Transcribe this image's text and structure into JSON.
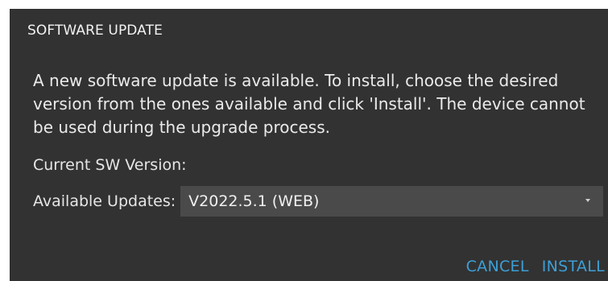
{
  "dialog": {
    "title": "SOFTWARE UPDATE",
    "message": "A new software update is available. To install, choose the desired version from the ones available and click 'Install'. The device cannot be used during the upgrade process.",
    "current_version_label": "Current SW Version:",
    "current_version_value": "",
    "available_updates_label": "Available Updates:",
    "selected_update": "V2022.5.1 (WEB)",
    "cancel_label": "CANCEL",
    "install_label": "INSTALL"
  },
  "colors": {
    "dialog_background": "#323232",
    "select_background": "#4a4a4a",
    "text": "#ececec",
    "accent": "#3d9fd6"
  },
  "icons": {
    "dropdown": "chevron-down-icon"
  }
}
